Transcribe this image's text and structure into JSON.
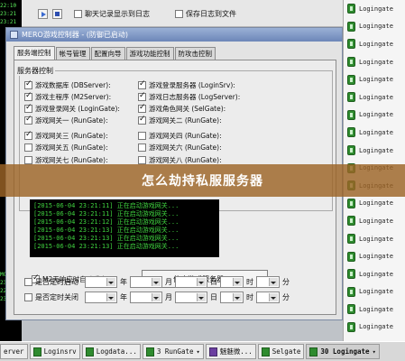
{
  "left_strip": {
    "lines": [
      "22:10",
      "23:21",
      "23:21",
      "",
      "",
      "",
      "",
      "",
      "",
      "",
      "",
      "",
      "",
      "",
      "",
      "",
      "",
      "",
      "",
      "",
      "",
      "",
      "",
      "",
      "",
      "",
      "",
      "",
      "",
      "",
      "",
      "",
      "",
      "",
      "",
      "",
      "",
      "",
      "",
      "",
      "MC",
      "23:21",
      "22:10",
      "23:21"
    ]
  },
  "toolbar": {
    "chat_log_label": "聊天记录显示到日志",
    "save_log_label": "保存日志到文件"
  },
  "window": {
    "title": "MERO游戏控制器 - (防御已启动)"
  },
  "tabs": [
    "服务端控制",
    "帐号管理",
    "配置向导",
    "游戏功能控制",
    "防攻击控制"
  ],
  "server_group": {
    "label": "服务器控制",
    "left": [
      {
        "label": "游戏数据库 (DBServer):",
        "checked": true
      },
      {
        "label": "游戏主程序 (M2Server):",
        "checked": true
      },
      {
        "label": "游戏登录网关 (LoginGate):",
        "checked": true
      },
      {
        "label": "游戏网关一 (RunGate):",
        "checked": true
      },
      {
        "label": "游戏网关三 (RunGate):",
        "checked": true
      },
      {
        "label": "游戏网关五 (RunGate):",
        "checked": false
      },
      {
        "label": "游戏网关七 (RunGate):",
        "checked": false
      }
    ],
    "right": [
      {
        "label": "游戏登录服务器 (LoginSrv):",
        "checked": true
      },
      {
        "label": "游戏日志服务器 (LogServer):",
        "checked": true
      },
      {
        "label": "游戏角色网关 (SelGate):",
        "checked": true
      },
      {
        "label": "游戏网关二 (RunGate):",
        "checked": true
      },
      {
        "label": "游戏网关四 (RunGate):",
        "checked": false
      },
      {
        "label": "游戏网关六 (RunGate):",
        "checked": false
      },
      {
        "label": "游戏网关八 (RunGate):",
        "checked": false
      }
    ]
  },
  "log": {
    "lines": [
      "[2015-06-04 23:21:11] 正在启动游戏网关...",
      "[2015-06-04 23:21:11] 正在启动游戏网关...",
      "[2015-06-04 23:21:12] 正在启动游戏网关...",
      "[2015-06-04 23:21:13] 正在启动游戏网关...",
      "[2015-06-04 23:21:13] 正在启动游戏网关...",
      "[2015-06-04 23:21:13] 正在启动游戏网关..."
    ]
  },
  "auto_restart_label": "M2无响应时自动重启",
  "stop_button_label": "停止游戏服务器 (T)",
  "schedule": {
    "start_label": "是否定时启动",
    "stop_label": "是否定时关闭",
    "units": [
      "年",
      "月",
      "日",
      "时",
      "分"
    ]
  },
  "banner_text": "怎么劫持私服服务器",
  "right_list": [
    "Logingate",
    "Logingate",
    "Logingate",
    "Logingate",
    "Logingate",
    "Logingate",
    "Logingate",
    "Logingate",
    "Logingate",
    "Logingate",
    "Logingate",
    "Logingate",
    "Logingate",
    "Logingate",
    "Logingate",
    "Logingate",
    "Logingate",
    "Logingate",
    "Logingate"
  ],
  "taskbar": [
    {
      "label": "erver"
    },
    {
      "label": "Loginsrv"
    },
    {
      "label": "Logdata..."
    },
    {
      "label": "3 RunGate",
      "arrow": "▾"
    },
    {
      "label": "魅魅微..."
    },
    {
      "label": "Selgate"
    },
    {
      "label": "30 Logingate",
      "arrow": "▾"
    }
  ],
  "colors": {
    "banner": "#9c6426",
    "log_text": "#3fd23f",
    "titlebar": "#6c86b8"
  }
}
